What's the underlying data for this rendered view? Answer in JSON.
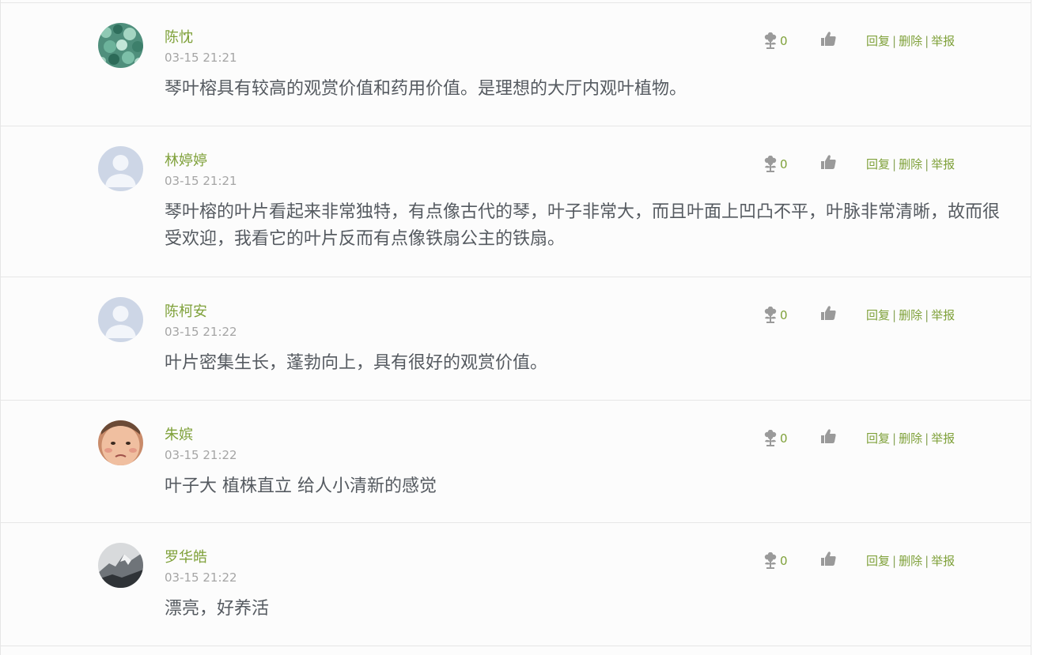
{
  "comments": [
    {
      "author": "陈忱",
      "time": "03-15 21:21",
      "text": "琴叶榕具有较高的观赏价值和药用价值。是理想的大厅内观叶植物。",
      "flower_count": "0",
      "avatar": "leaf-photo"
    },
    {
      "author": "林婷婷",
      "time": "03-15 21:21",
      "text": "琴叶榕的叶片看起来非常独特，有点像古代的琴，叶子非常大，而且叶面上凹凸不平，叶脉非常清晰，故而很受欢迎，我看它的叶片反而有点像铁扇公主的铁扇。",
      "flower_count": "0",
      "avatar": "default-user"
    },
    {
      "author": "陈柯安",
      "time": "03-15 21:22",
      "text": "叶片密集生长，蓬勃向上，具有很好的观赏价值。",
      "flower_count": "0",
      "avatar": "default-user"
    },
    {
      "author": "朱嫔",
      "time": "03-15 21:22",
      "text": "叶子大 植株直立 给人小清新的感觉",
      "flower_count": "0",
      "avatar": "baby-photo"
    },
    {
      "author": "罗华皓",
      "time": "03-15 21:22",
      "text": "漂亮，好养活",
      "flower_count": "0",
      "avatar": "mountain-photo"
    }
  ],
  "actions": {
    "reply": "回复",
    "delete": "删除",
    "report": "举报",
    "separator": "|"
  },
  "icons": {
    "flower": "flower-icon",
    "like": "thumbs-up-icon"
  },
  "colors": {
    "accent": "#7fa13a",
    "text": "#555a60",
    "muted": "#a5a5a5",
    "icon": "#9a9a9a",
    "border": "#e6e6e6"
  }
}
